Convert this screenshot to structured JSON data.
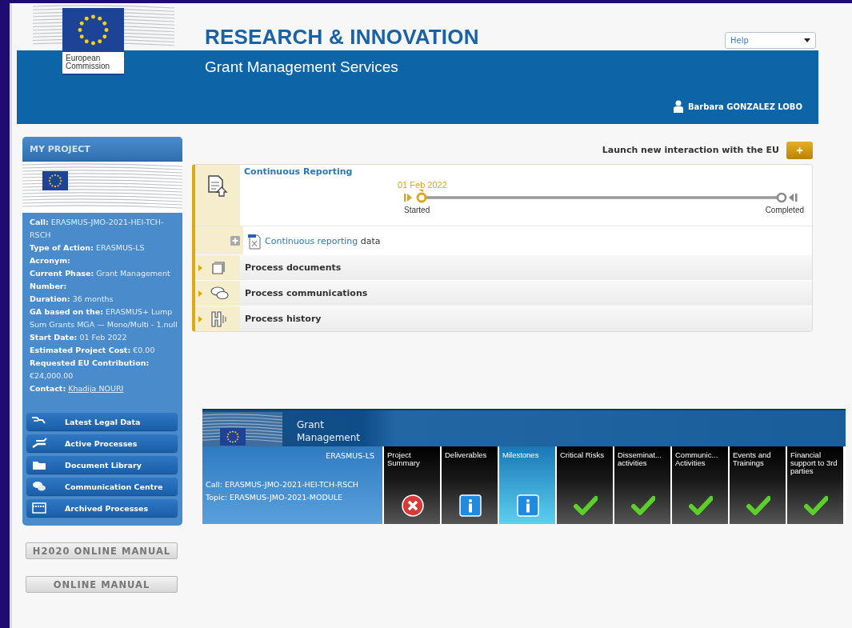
{
  "header": {
    "logo_text": "European Commission",
    "title": "RESEARCH & INNOVATION",
    "subtitle": "Grant Management Services",
    "help_select": {
      "value": "Help"
    },
    "user": "Barbara GONZALEZ LOBO"
  },
  "sidebar": {
    "title": "MY PROJECT",
    "fields": [
      {
        "label": "Call:",
        "value": "ERASMUS-JMO-2021-HEI-TCH-RSCH"
      },
      {
        "label": "Type of Action:",
        "value": "ERASMUS-LS"
      },
      {
        "label": "Acronym:"
      },
      {
        "label": "Current Phase:",
        "value": "Grant Management"
      },
      {
        "label": "Number:"
      },
      {
        "label": "Duration:",
        "value": "36 months"
      },
      {
        "label": "GA based on the:",
        "value": "ERASMUS+ Lump Sum Grants MGA — Mono/Multi - 1.null"
      },
      {
        "label": "Start Date:",
        "value": "01 Feb 2022"
      },
      {
        "label": "Estimated Project Cost:",
        "value": "€0.00"
      },
      {
        "label": "Requested EU Contribution:",
        "value": "€24,000.00"
      },
      {
        "label": "Contact:",
        "value": "Khadija NOURI",
        "kind": "link"
      }
    ],
    "nav": [
      {
        "label": "Latest Legal Data",
        "kind": "legal"
      },
      {
        "label": "Active Processes",
        "kind": "active"
      },
      {
        "label": "Document Library",
        "kind": "library"
      },
      {
        "label": "Communication Centre",
        "kind": "communication"
      },
      {
        "label": "Archived Processes",
        "kind": "archive"
      }
    ],
    "manual_buttons": [
      "H2020 ONLINE MANUAL",
      "ONLINE MANUAL"
    ]
  },
  "main": {
    "launch": {
      "label": "Launch new interaction with the EU",
      "button": "+"
    },
    "process": {
      "title": "Continuous Reporting",
      "timeline": {
        "date": "01 Feb 2022",
        "start": "Started",
        "end": "Completed"
      },
      "data_row": {
        "link": "Continuous reporting",
        "text": "data"
      },
      "sections": [
        {
          "label": "Process documents",
          "kind": "documents",
          "expanded": false
        },
        {
          "label": "Process communications",
          "kind": "communications",
          "expanded": false
        },
        {
          "label": "Process history",
          "kind": "history",
          "expanded": false
        }
      ]
    }
  },
  "grant_widget": {
    "title": "Grant Management",
    "action_type": "ERASMUS-LS",
    "call": "Call: ERASMUS-JMO-2021-HEI-TCH-RSCH",
    "topic": "Topic: ERASMUS-JMO-2021-MODULE",
    "tiles": [
      {
        "label": "Project Summary",
        "kind": "error",
        "selected": false
      },
      {
        "label": "Deliverables",
        "kind": "info",
        "selected": false
      },
      {
        "label": "Milestones",
        "kind": "info",
        "selected": true
      },
      {
        "label": "Critical Risks",
        "kind": "ok",
        "selected": false
      },
      {
        "label": "Disseminat... activities",
        "kind": "ok",
        "selected": false
      },
      {
        "label": "Communic... Activities",
        "kind": "ok",
        "selected": false
      },
      {
        "label": "Events and Trainings",
        "kind": "ok",
        "selected": false
      },
      {
        "label": "Financial support to 3rd parties",
        "kind": "ok",
        "selected": false
      }
    ]
  }
}
